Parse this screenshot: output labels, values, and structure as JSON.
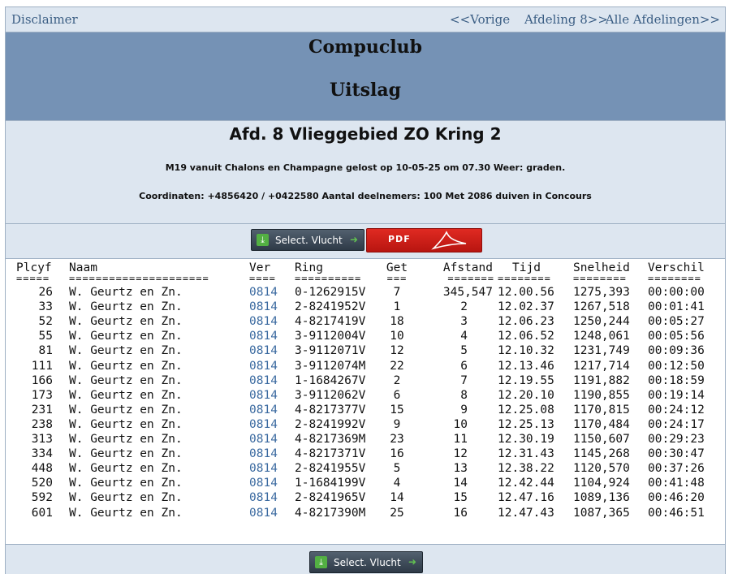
{
  "nav": {
    "disclaimer": "Disclaimer",
    "prev": "<<Vorige",
    "afdeling": "Afdeling 8>>",
    "all": "Alle Afdelingen>>"
  },
  "banner": {
    "club": "Compuclub",
    "subtitle": "Uitslag"
  },
  "info": {
    "afdeling": "Afd. 8 Vlieggebied ZO Kring 2",
    "release": "M19 vanuit Chalons en Champagne gelost op 10-05-25 om 07.30 Weer: graden.",
    "coords": "Coordinaten: +4856420 / +0422580 Aantal deelnemers: 100 Met 2086 duiven in Concours"
  },
  "buttons": {
    "select_vlucht": "Select. Vlucht",
    "pdf": "PDF"
  },
  "colors": {
    "banner": "#7592b5",
    "panel": "#dde6f0",
    "link": "#3b6aa0",
    "pdf": "#c81c16"
  },
  "table": {
    "headers": {
      "plcyf": "Plcyf",
      "naam": "Naam",
      "ver": "Ver",
      "ring": "Ring",
      "get": "Get",
      "afstand": "Afstand",
      "tijd": "Tijd",
      "snelheid": "Snelheid",
      "verschil": "Verschil"
    },
    "separators": {
      "plcyf": "=====",
      "naam": "=====================",
      "ver": "====",
      "ring": "==========",
      "get": "===",
      "afstand": "=======",
      "tijd": "========",
      "snelheid": "========",
      "verschil": "========"
    },
    "rows": [
      {
        "plcyf": "26",
        "naam": "W. Geurtz en Zn.",
        "ver": "0814",
        "ring": "0-1262915V",
        "get": "7",
        "afstand": "345,547",
        "tijd": "12.00.56",
        "snelheid": "1275,393",
        "verschil": "00:00:00"
      },
      {
        "plcyf": "33",
        "naam": "W. Geurtz en Zn.",
        "ver": "0814",
        "ring": "2-8241952V",
        "get": "1",
        "afstand": "2",
        "tijd": "12.02.37",
        "snelheid": "1267,518",
        "verschil": "00:01:41"
      },
      {
        "plcyf": "52",
        "naam": "W. Geurtz en Zn.",
        "ver": "0814",
        "ring": "4-8217419V",
        "get": "18",
        "afstand": "3",
        "tijd": "12.06.23",
        "snelheid": "1250,244",
        "verschil": "00:05:27"
      },
      {
        "plcyf": "55",
        "naam": "W. Geurtz en Zn.",
        "ver": "0814",
        "ring": "3-9112004V",
        "get": "10",
        "afstand": "4",
        "tijd": "12.06.52",
        "snelheid": "1248,061",
        "verschil": "00:05:56"
      },
      {
        "plcyf": "81",
        "naam": "W. Geurtz en Zn.",
        "ver": "0814",
        "ring": "3-9112071V",
        "get": "12",
        "afstand": "5",
        "tijd": "12.10.32",
        "snelheid": "1231,749",
        "verschil": "00:09:36"
      },
      {
        "plcyf": "111",
        "naam": "W. Geurtz en Zn.",
        "ver": "0814",
        "ring": "3-9112074M",
        "get": "22",
        "afstand": "6",
        "tijd": "12.13.46",
        "snelheid": "1217,714",
        "verschil": "00:12:50"
      },
      {
        "plcyf": "166",
        "naam": "W. Geurtz en Zn.",
        "ver": "0814",
        "ring": "1-1684267V",
        "get": "2",
        "afstand": "7",
        "tijd": "12.19.55",
        "snelheid": "1191,882",
        "verschil": "00:18:59"
      },
      {
        "plcyf": "173",
        "naam": "W. Geurtz en Zn.",
        "ver": "0814",
        "ring": "3-9112062V",
        "get": "6",
        "afstand": "8",
        "tijd": "12.20.10",
        "snelheid": "1190,855",
        "verschil": "00:19:14"
      },
      {
        "plcyf": "231",
        "naam": "W. Geurtz en Zn.",
        "ver": "0814",
        "ring": "4-8217377V",
        "get": "15",
        "afstand": "9",
        "tijd": "12.25.08",
        "snelheid": "1170,815",
        "verschil": "00:24:12"
      },
      {
        "plcyf": "238",
        "naam": "W. Geurtz en Zn.",
        "ver": "0814",
        "ring": "2-8241992V",
        "get": "9",
        "afstand": "10",
        "tijd": "12.25.13",
        "snelheid": "1170,484",
        "verschil": "00:24:17"
      },
      {
        "plcyf": "313",
        "naam": "W. Geurtz en Zn.",
        "ver": "0814",
        "ring": "4-8217369M",
        "get": "23",
        "afstand": "11",
        "tijd": "12.30.19",
        "snelheid": "1150,607",
        "verschil": "00:29:23"
      },
      {
        "plcyf": "334",
        "naam": "W. Geurtz en Zn.",
        "ver": "0814",
        "ring": "4-8217371V",
        "get": "16",
        "afstand": "12",
        "tijd": "12.31.43",
        "snelheid": "1145,268",
        "verschil": "00:30:47"
      },
      {
        "plcyf": "448",
        "naam": "W. Geurtz en Zn.",
        "ver": "0814",
        "ring": "2-8241955V",
        "get": "5",
        "afstand": "13",
        "tijd": "12.38.22",
        "snelheid": "1120,570",
        "verschil": "00:37:26"
      },
      {
        "plcyf": "520",
        "naam": "W. Geurtz en Zn.",
        "ver": "0814",
        "ring": "1-1684199V",
        "get": "4",
        "afstand": "14",
        "tijd": "12.42.44",
        "snelheid": "1104,924",
        "verschil": "00:41:48"
      },
      {
        "plcyf": "592",
        "naam": "W. Geurtz en Zn.",
        "ver": "0814",
        "ring": "2-8241965V",
        "get": "14",
        "afstand": "15",
        "tijd": "12.47.16",
        "snelheid": "1089,136",
        "verschil": "00:46:20"
      },
      {
        "plcyf": "601",
        "naam": "W. Geurtz en Zn.",
        "ver": "0814",
        "ring": "4-8217390M",
        "get": "25",
        "afstand": "16",
        "tijd": "12.47.43",
        "snelheid": "1087,365",
        "verschil": "00:46:51"
      }
    ]
  }
}
